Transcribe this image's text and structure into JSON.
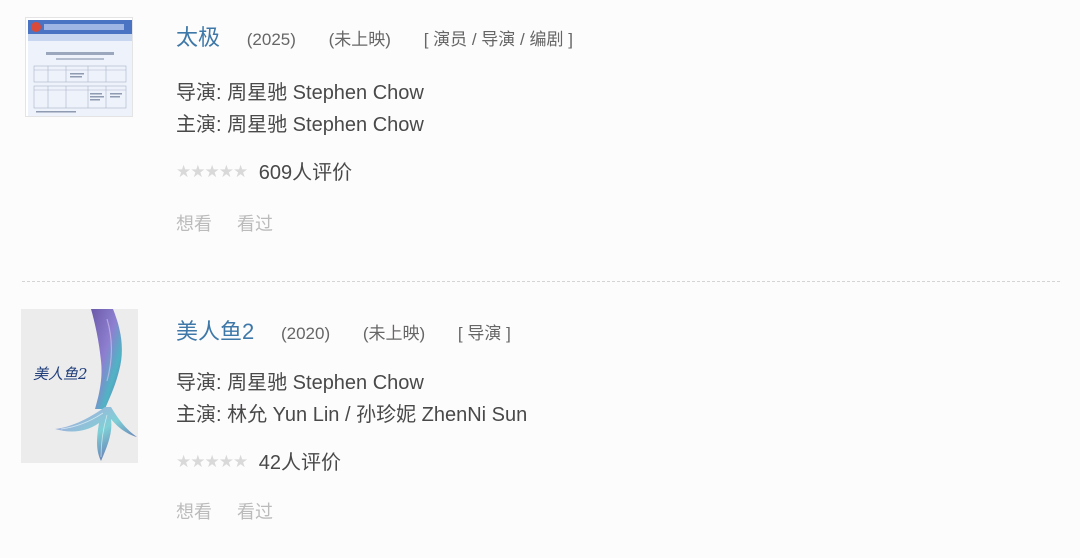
{
  "films": [
    {
      "title": "太极",
      "year": "(2025)",
      "status": "(未上映)",
      "roles": "[ 演员 / 导演 / 编剧 ]",
      "director": "导演: 周星驰 Stephen Chow",
      "cast": "主演: 周星驰 Stephen Chow",
      "rating_stars": "★★★★★",
      "rating_count": "609人评价",
      "want_label": "想看",
      "seen_label": "看过"
    },
    {
      "title": "美人鱼2",
      "year": "(2020)",
      "status": "(未上映)",
      "roles": "[ 导演 ]",
      "director": "导演: 周星驰 Stephen Chow",
      "cast": "主演: 林允 Yun Lin / 孙珍妮 ZhenNi Sun",
      "rating_stars": "★★★★★",
      "rating_count": "42人评价",
      "want_label": "想看",
      "seen_label": "看过",
      "poster_text": "美人鱼2"
    }
  ],
  "colors": {
    "title_link": "#3e78a8",
    "action_text": "#bbbbbb",
    "star_empty": "#d9d9d9"
  }
}
